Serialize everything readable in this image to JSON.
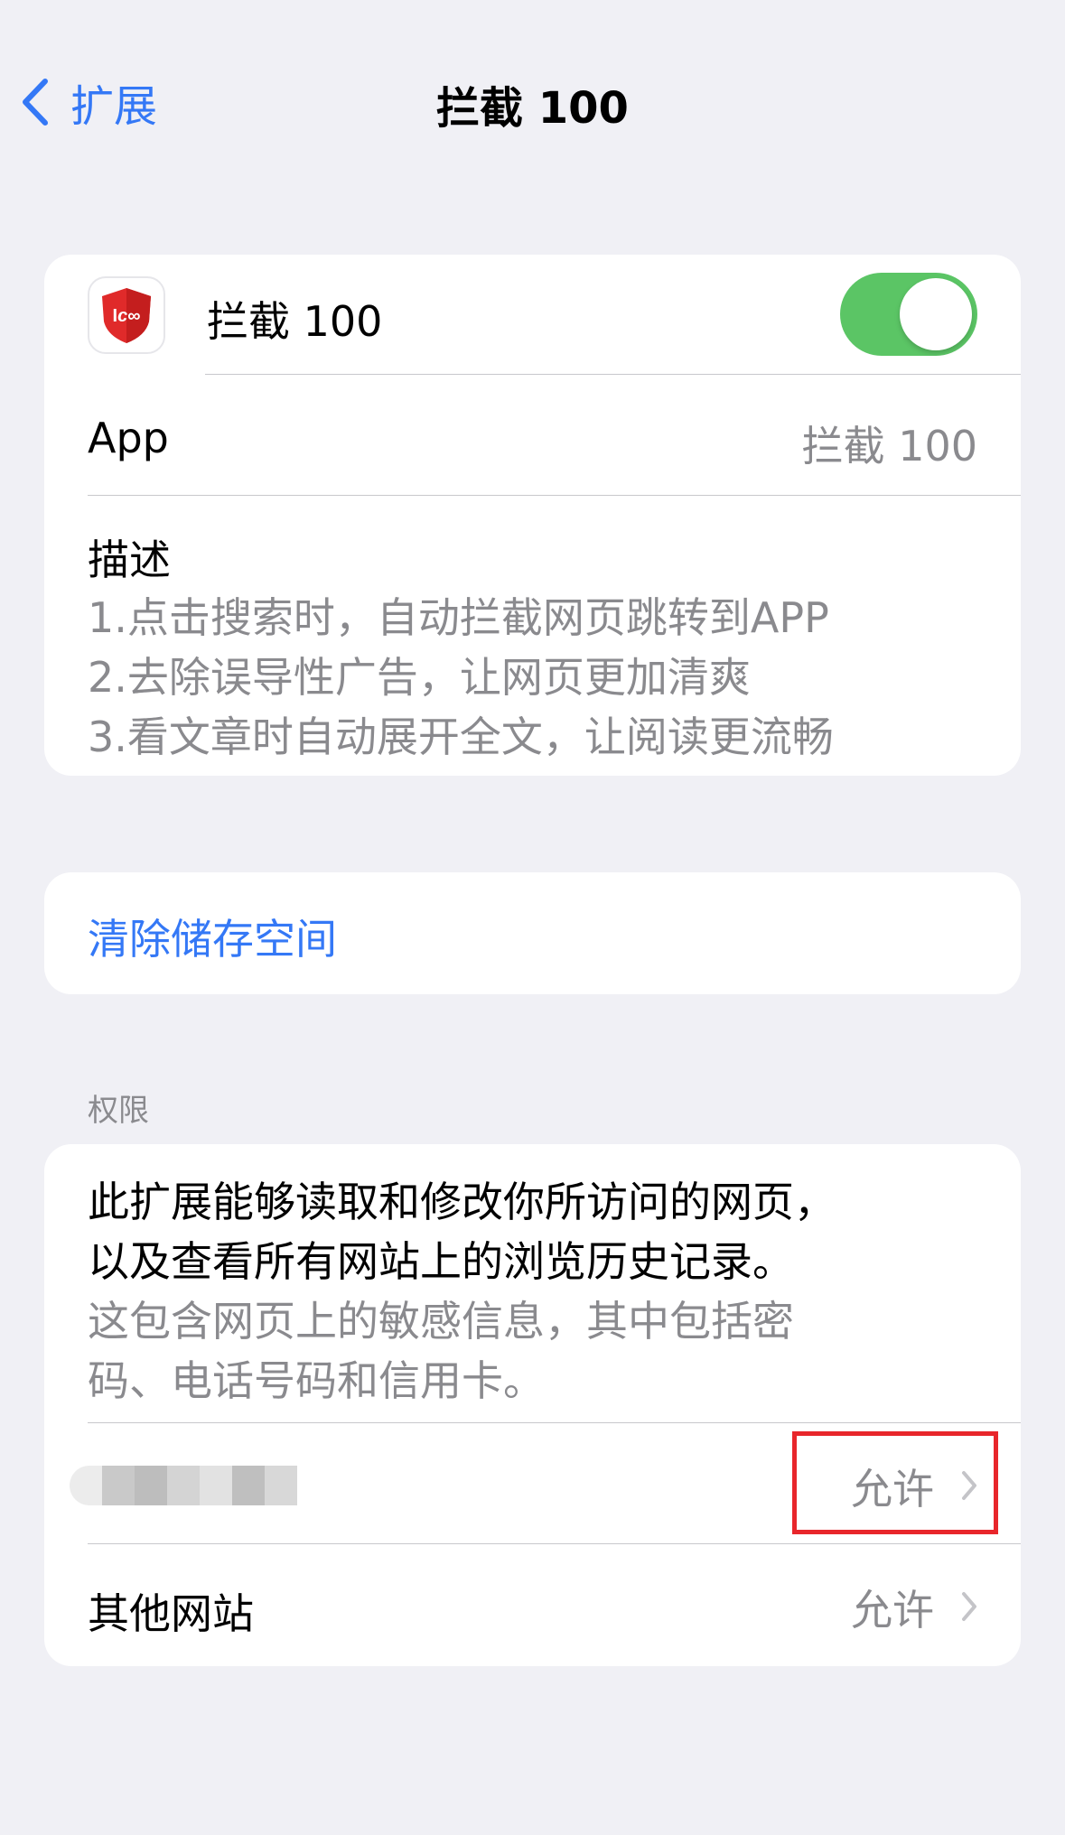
{
  "nav": {
    "back_label": "扩展",
    "title": "拦截 100"
  },
  "extension": {
    "name": "拦截 100",
    "enabled": true,
    "app_label": "App",
    "app_value": "拦截 100",
    "description_title": "描述",
    "description_lines": [
      "1.点击搜索时，自动拦截网页跳转到APP",
      "2.去除误导性广告，让网页更加清爽",
      "3.看文章时自动展开全文，让阅读更流畅"
    ]
  },
  "storage": {
    "clear_label": "清除储存空间"
  },
  "permissions": {
    "header": "权限",
    "notice_lines": [
      "此扩展能够读取和修改你所访问的网页，",
      "以及查看所有网站上的浏览历史记录。"
    ],
    "sub_lines": [
      "这包含网页上的敏感信息，其中包括密",
      "码、电话号码和信用卡。"
    ],
    "current_site_value": "允许",
    "other_sites_label": "其他网站",
    "other_sites_value": "允许"
  },
  "colors": {
    "background": "#f0f0f5",
    "accent": "#3478f6",
    "toggle_on": "#5bc565",
    "secondary_text": "#8a8a8e",
    "highlight": "#e8262b"
  }
}
